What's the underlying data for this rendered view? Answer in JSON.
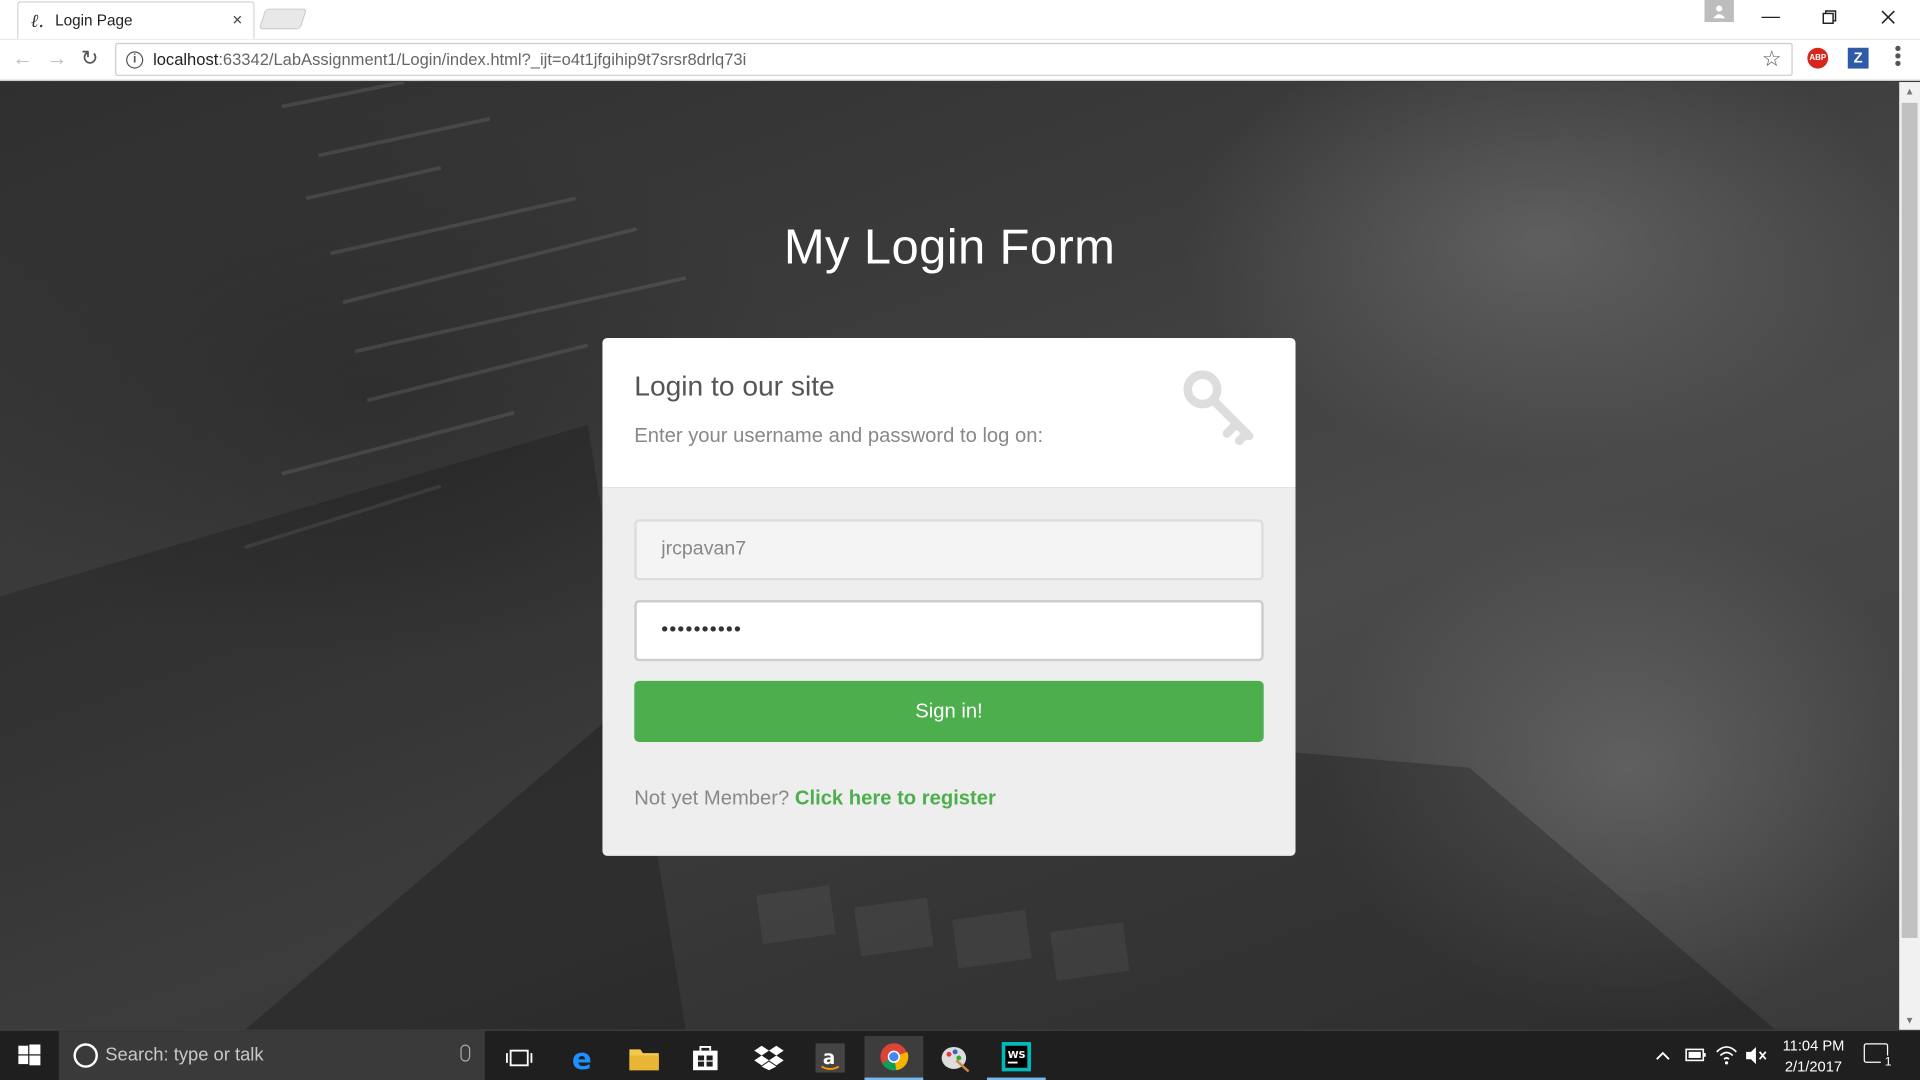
{
  "browser": {
    "tab_title": "Login Page",
    "tab_favicon": "ℓ.",
    "tab_close": "×",
    "url_host": "localhost",
    "url_path": ":63342/LabAssignment1/Login/index.html?_ijt=o4t1jfgihip9t7srsr8drlq73i",
    "ext_abp_label": "ABP",
    "ext_z_label": "Z"
  },
  "page": {
    "heading": "My Login Form",
    "card_title": "Login to our site",
    "card_subtitle": "Enter your username and password to log on:",
    "username_value": "jrcpavan7",
    "password_value": "••••••••••",
    "signin_label": "Sign in!",
    "register_prompt": "Not yet Member?",
    "register_link": "Click here to register"
  },
  "taskbar": {
    "search_placeholder": "Search: type or talk",
    "time": "11:04 PM",
    "date": "2/1/2017",
    "notification_count": "1",
    "pinned": [
      "task-view-icon",
      "edge-icon",
      "file-explorer-icon",
      "store-icon",
      "dropbox-icon",
      "amazon-icon",
      "chrome-icon",
      "paint-icon",
      "webstorm-icon"
    ]
  },
  "colors": {
    "accent_green": "#4cae4c",
    "taskbar": "#1f1f1f"
  }
}
